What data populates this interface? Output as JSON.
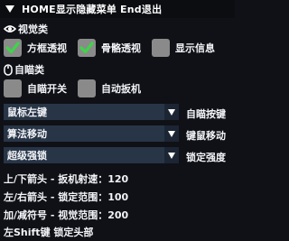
{
  "window": {
    "title": "HOME显示隐藏菜单 End退出"
  },
  "visual": {
    "header": "视觉类",
    "options": [
      {
        "label": "方框透视",
        "checked": true
      },
      {
        "label": "骨骼透视",
        "checked": true
      },
      {
        "label": "显示信息",
        "checked": false
      }
    ]
  },
  "aimbot": {
    "header": "自瞄类",
    "options": [
      {
        "label": "自瞄开关",
        "checked": false
      },
      {
        "label": "自动扳机",
        "checked": false
      }
    ]
  },
  "combos": [
    {
      "value": "鼠标左键",
      "label": "自瞄按键"
    },
    {
      "value": "算法移动",
      "label": "键鼠移动"
    },
    {
      "value": "超级强锁",
      "label": "锁定强度"
    }
  ],
  "info": [
    "上/下箭头 - 扳机射速：120",
    "左/右箭头 - 锁定范围：100",
    "加/减符号 - 视觉范围：200",
    "左Shift键 锁定头部"
  ],
  "colors": {
    "check_mark": "#3fd44a",
    "check_box": "#8a8a8a",
    "combo_bg": "#283547",
    "background": "#0f1116"
  }
}
